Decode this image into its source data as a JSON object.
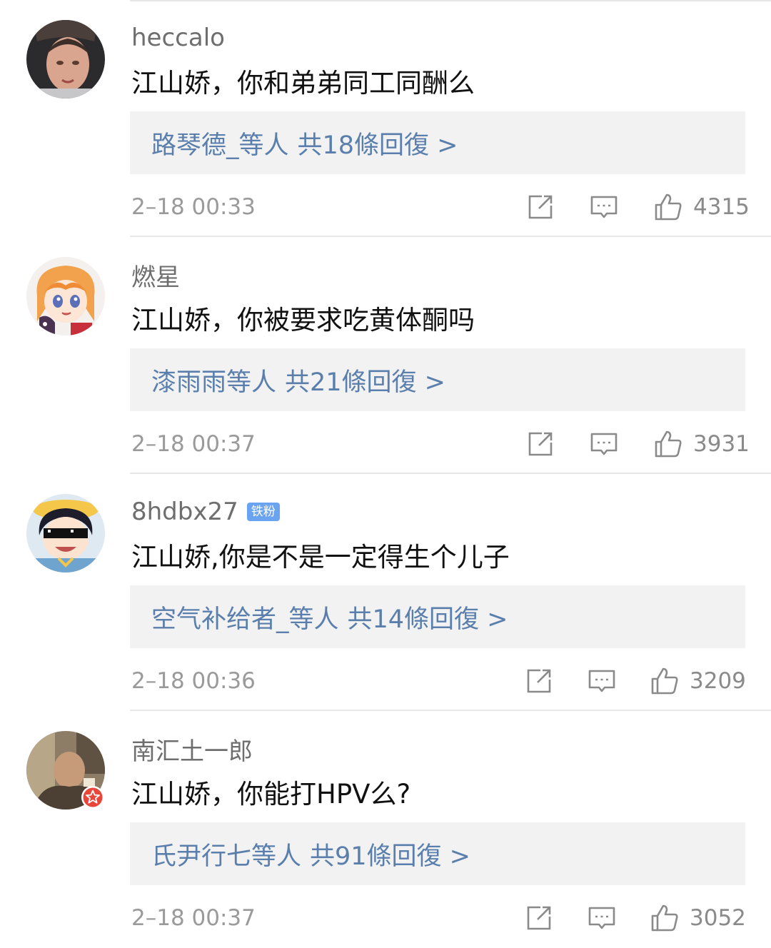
{
  "comments": [
    {
      "username": "heccalo",
      "badge": "",
      "content": "江山娇，你和弟弟同工同酬么",
      "reply_names": "路琴德_等人",
      "reply_count": "共18條回復 >",
      "timestamp": "2–18 00:33",
      "likes": "4315",
      "avatar_icon": "avatar-photo-man",
      "verified": false
    },
    {
      "username": "燃星",
      "badge": "",
      "content": "江山娇，你被要求吃黄体酮吗",
      "reply_names": "漆雨雨等人",
      "reply_count": "共21條回復 >",
      "timestamp": "2–18 00:37",
      "likes": "3931",
      "avatar_icon": "avatar-anime-girl",
      "verified": false
    },
    {
      "username": "8hdbx27",
      "badge": "铁粉",
      "content": "江山娇,你是不是一定得生个儿子",
      "reply_names": "空气补给者_等人",
      "reply_count": "共14條回復 >",
      "timestamp": "2–18 00:36",
      "likes": "3209",
      "avatar_icon": "avatar-cartoon-sunglasses",
      "verified": false
    },
    {
      "username": "南汇土一郎",
      "badge": "",
      "content": "江山娇，你能打HPV么?",
      "reply_names": "氏尹行七等人",
      "reply_count": "共91條回復 >",
      "timestamp": "2–18 00:37",
      "likes": "3052",
      "avatar_icon": "avatar-photo-person",
      "verified": true
    }
  ],
  "colors": {
    "reply_link": "#5a7fad",
    "reply_bg": "#f2f2f2",
    "username": "#6e6e6e",
    "content": "#111111",
    "meta": "#9a9a9a",
    "fan_badge": "#6aa3f0",
    "verified_badge": "#e9463b"
  },
  "icons": {
    "share": "share-icon",
    "comment": "comment-icon",
    "like": "thumbs-up-icon"
  }
}
